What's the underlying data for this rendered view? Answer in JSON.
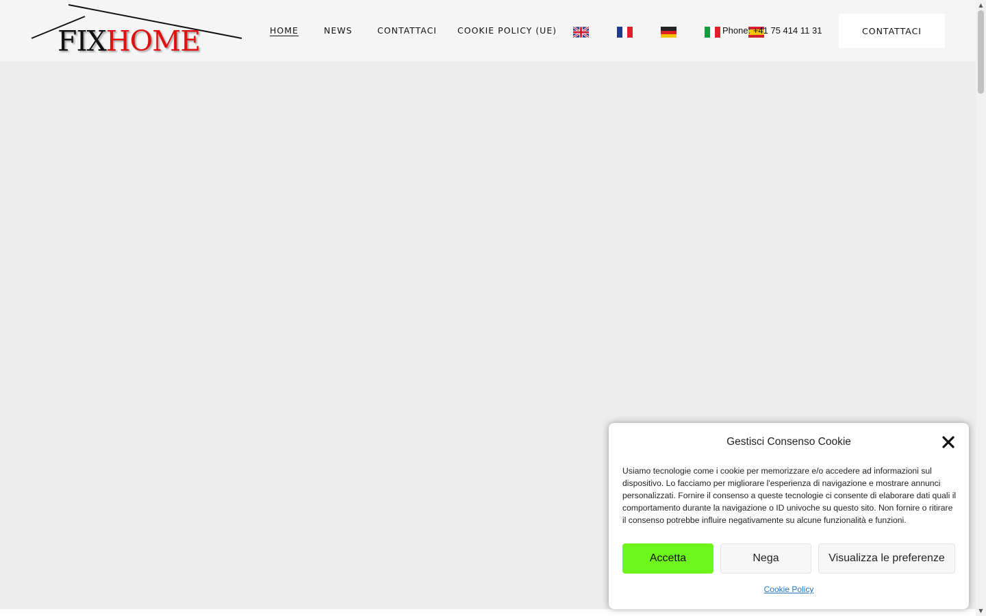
{
  "logo": {
    "part1": "FIX",
    "part2": "HOME"
  },
  "nav": {
    "items": [
      {
        "label": "HOME",
        "active": true
      },
      {
        "label": "NEWS",
        "active": false
      },
      {
        "label": "CONTATTACI",
        "active": false
      },
      {
        "label": "COOKIE POLICY (UE)",
        "active": false
      }
    ]
  },
  "flags": [
    {
      "icon": "uk-flag-icon"
    },
    {
      "icon": "france-flag-icon"
    },
    {
      "icon": "germany-flag-icon"
    },
    {
      "icon": "italy-flag-icon"
    },
    {
      "icon": "spain-flag-icon"
    }
  ],
  "header": {
    "phone": "Phone: +41 75 414 11 31",
    "cta_label": "CONTATTACI"
  },
  "cookie": {
    "title": "Gestisci Consenso Cookie",
    "text": "Usiamo tecnologie come i cookie per memorizzare e/o accedere ad informazioni sul dispositivo. Lo facciamo per migliorare l'esperienza di navigazione e mostrare annunci personalizzati. Fornire il consenso a queste tecnologie ci consente di elaborare dati quali il comportamento durante la navigazione o ID univoche su questo sito. Non fornire o ritirare il consenso potrebbe influire negativamente su alcune funzionalità e funzioni.",
    "accept_label": "Accetta",
    "deny_label": "Nega",
    "prefs_label": "Visualizza le preferenze",
    "policy_link": "Cookie Policy"
  },
  "colors": {
    "brand_red": "#e01010",
    "accept_green": "#6ef51b",
    "link_blue": "#1e73be"
  }
}
